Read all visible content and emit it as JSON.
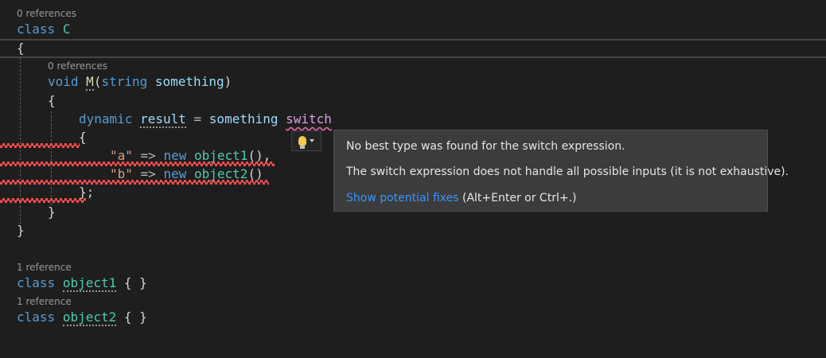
{
  "lenses": {
    "class_c": "0 references",
    "method_m": "0 references",
    "object1": "1 reference",
    "object2": "1 reference"
  },
  "code": {
    "kw_class": "class",
    "kw_void": "void",
    "kw_string": "string",
    "kw_dynamic": "dynamic",
    "kw_new": "new",
    "ctl_switch": "switch",
    "class_c_name": "C",
    "method_name": "M",
    "param_name": "something",
    "var_result": "result",
    "switch_operand": "something",
    "str_a": "\"a\"",
    "str_b": "\"b\"",
    "type_object1": "object1",
    "type_object2": "object2",
    "open_brace": "{",
    "close_brace": "}",
    "close_switch": "};",
    "paren_open": "(",
    "paren_close": ")",
    "call_parens_comma": "(),",
    "call_parens": "()",
    "arrow": "=>",
    "equals": "=",
    "empty_body": "{ }"
  },
  "tooltip": {
    "line1": "No best type was found for the switch expression.",
    "line2": "The switch expression does not handle all possible inputs (it is not exhaustive).",
    "fix_link": "Show potential fixes",
    "fix_hint": "(Alt+Enter or Ctrl+.)"
  },
  "lightbulb": {
    "icon": "lightbulb-icon",
    "color": "#f2c94c"
  },
  "colors": {
    "background": "#1e1e1e",
    "keyword": "#569cd6",
    "type": "#4ec9b0",
    "identifier": "#9cdcfe",
    "method": "#dcdcaa",
    "string": "#d69d85",
    "control": "#d8a0df",
    "error": "#f14c4c",
    "link": "#3794ff"
  }
}
